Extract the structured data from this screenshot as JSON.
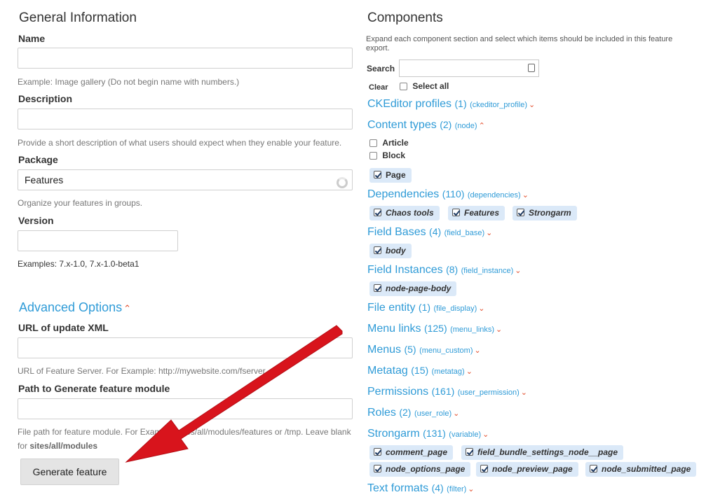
{
  "general": {
    "heading": "General Information",
    "name_label": "Name",
    "name_value": "",
    "name_desc": "Example: Image gallery (Do not begin name with numbers.)",
    "description_label": "Description",
    "description_value": "",
    "description_desc": "Provide a short description of what users should expect when they enable your feature.",
    "package_label": "Package",
    "package_value": "Features",
    "package_desc": "Organize your features in groups.",
    "version_label": "Version",
    "version_value": "",
    "version_desc": "Examples: 7.x-1.0, 7.x-1.0-beta1"
  },
  "advanced": {
    "heading": "Advanced Options",
    "url_label": "URL of update XML",
    "url_desc": "URL of Feature Server. For Example: http://mywebsite.com/fserver",
    "path_label": "Path to Generate feature module",
    "path_desc": "File path for feature module. For Example: sites/all/modules/features or /tmp. Leave blank",
    "path_desc_prefix": "for ",
    "path_desc_default": "sites/all/modules",
    "generate_button": "Generate feature"
  },
  "components": {
    "heading": "Components",
    "help": "Expand each component section and select which items should be included in this feature export.",
    "search_label": "Search",
    "search_value": "",
    "clear_label": "Clear",
    "select_all_label": "Select all",
    "items": [
      {
        "name": "CKEditor profiles",
        "count": "(1)",
        "machine": "(ckeditor_profile)"
      },
      {
        "name": "Content types",
        "count": "(2)",
        "machine": "(node)"
      },
      {
        "name": "Dependencies",
        "count": "(110)",
        "machine": "(dependencies)"
      },
      {
        "name": "Field Bases",
        "count": "(4)",
        "machine": "(field_base)"
      },
      {
        "name": "Field Instances",
        "count": "(8)",
        "machine": "(field_instance)"
      },
      {
        "name": "File entity",
        "count": "(1)",
        "machine": "(file_display)"
      },
      {
        "name": "Menu links",
        "count": "(125)",
        "machine": "(menu_links)"
      },
      {
        "name": "Menus",
        "count": "(5)",
        "machine": "(menu_custom)"
      },
      {
        "name": "Metatag",
        "count": "(15)",
        "machine": "(metatag)"
      },
      {
        "name": "Permissions",
        "count": "(161)",
        "machine": "(user_permission)"
      },
      {
        "name": "Roles",
        "count": "(2)",
        "machine": "(user_role)"
      },
      {
        "name": "Strongarm",
        "count": "(131)",
        "machine": "(variable)"
      },
      {
        "name": "Text formats",
        "count": "(4)",
        "machine": "(filter)"
      }
    ],
    "content_types_unchecked": [
      "Article",
      "Block"
    ],
    "content_types_checked": [
      "Page"
    ],
    "dependencies_checked": [
      "Chaos tools",
      "Features",
      "Strongarm"
    ],
    "field_bases_checked": [
      "body"
    ],
    "field_instances_checked": [
      "node-page-body"
    ],
    "strongarm_checked": [
      "comment_page",
      "field_bundle_settings_node__page",
      "node_options_page",
      "node_preview_page",
      "node_submitted_page"
    ]
  },
  "colors": {
    "link": "#2f9bd7",
    "chevron": "#e24b29",
    "chip_bg": "#dbe9f8",
    "arrow": "#d8141c"
  }
}
